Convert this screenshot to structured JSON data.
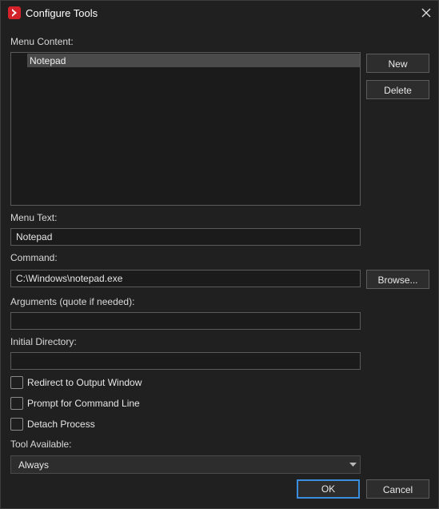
{
  "window": {
    "title": "Configure Tools"
  },
  "menu_content": {
    "label": "Menu Content:",
    "items": [
      "Notepad"
    ]
  },
  "buttons": {
    "new": "New",
    "delete": "Delete",
    "browse": "Browse...",
    "ok": "OK",
    "cancel": "Cancel"
  },
  "menu_text": {
    "label": "Menu Text:",
    "value": "Notepad"
  },
  "command": {
    "label": "Command:",
    "value": "C:\\Windows\\notepad.exe"
  },
  "arguments": {
    "label": "Arguments (quote if needed):",
    "value": ""
  },
  "initial_directory": {
    "label": "Initial Directory:",
    "value": ""
  },
  "checkboxes": {
    "redirect": {
      "label": "Redirect to Output Window",
      "checked": false
    },
    "prompt": {
      "label": "Prompt for Command Line",
      "checked": false
    },
    "detach": {
      "label": "Detach Process",
      "checked": false
    }
  },
  "tool_available": {
    "label": "Tool Available:",
    "value": "Always"
  },
  "icons": {
    "app": "app-logo-icon",
    "close": "close-icon",
    "dropdown": "chevron-down-icon"
  },
  "colors": {
    "accent": "#3b8ddd",
    "brand": "#d4222b",
    "background": "#202020"
  }
}
